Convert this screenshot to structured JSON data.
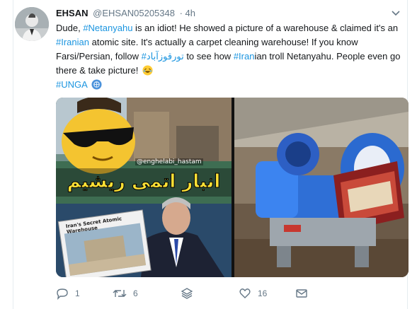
{
  "tweet": {
    "author": {
      "display_name": "EHSAN",
      "handle": "@EHSAN05205348",
      "time": "· 4h"
    },
    "text_parts": {
      "t1": "Dude, ",
      "tag_netanyahu": "#Netanyahu",
      "t2": " is an idiot! He showed a picture of a warehouse & claimed it's an ",
      "tag_iranian": "#Iranian",
      "t3": " atomic site. It's actually a carpet cleaning warehouse! If you know Farsi/Persian, follow ",
      "tag_farsi": "#تورقوزآباد",
      "t4": " to see how ",
      "tag_iran": "#Iran",
      "t5": "ian troll Netanyahu. People even go there & take picture!",
      "tag_unga": "#UNGA"
    },
    "media": {
      "left": {
        "watermark": "@enghelabi_hastam",
        "headline": "انبار اتمی ریشیم",
        "poster_caption": "Iran's Secret Atomic Warehouse"
      }
    },
    "actions": {
      "reply_count": "1",
      "retweet_count": "6",
      "like_count": "16"
    },
    "icons": [
      "chevron-down-icon",
      "reply-icon",
      "retweet-icon",
      "layers-icon",
      "like-icon",
      "message-icon",
      "un-emoji-icon",
      "laughing-emoji-icon"
    ],
    "colors": {
      "link": "#1b95e0",
      "muted": "#657786",
      "text": "#14171a"
    }
  }
}
